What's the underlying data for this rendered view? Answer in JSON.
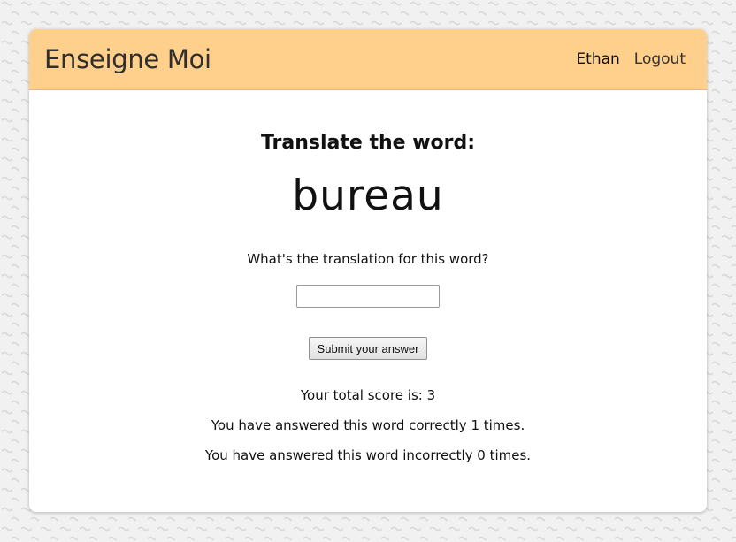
{
  "header": {
    "brand": "Enseigne Moi",
    "user_name": "Ethan",
    "logout_label": "Logout"
  },
  "quiz": {
    "prompt": "Translate the word:",
    "word": "bureau",
    "question": "What's the translation for this word?",
    "answer_value": "",
    "answer_placeholder": "",
    "submit_label": "Submit your answer"
  },
  "stats": {
    "total_score": "Your total score is: 3",
    "correct": "You have answered this word correctly 1 times.",
    "incorrect": "You have answered this word incorrectly 0 times."
  },
  "colors": {
    "header_bg": "#ffcf8c",
    "page_bg": "#f1f1f1",
    "card_bg": "#ffffff"
  }
}
